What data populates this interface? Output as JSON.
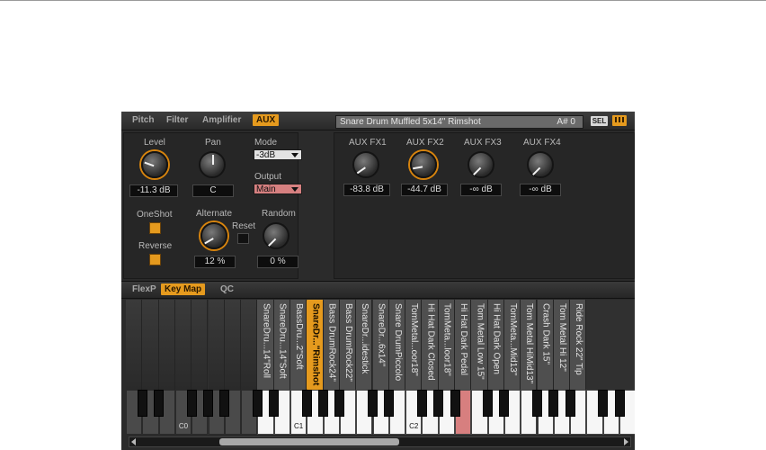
{
  "tabs": [
    "Pitch",
    "Filter",
    "Amplifier",
    "AUX"
  ],
  "active_tab": "AUX",
  "sample": {
    "name": "Snare Drum Muffled 5x14\" Rimshot",
    "note": "A# 0"
  },
  "sel_label": "SEL",
  "level": {
    "label": "Level",
    "value": "-11.3 dB"
  },
  "pan": {
    "label": "Pan",
    "value": "C"
  },
  "mode": {
    "label": "Mode",
    "value": "-3dB"
  },
  "output": {
    "label": "Output",
    "value": "Main"
  },
  "oneshot_label": "OneShot",
  "reverse_label": "Reverse",
  "alternate": {
    "label": "Alternate",
    "value": "12 %"
  },
  "reset_label": "Reset",
  "random": {
    "label": "Random",
    "value": "0 %"
  },
  "aux_fx": [
    {
      "label": "AUX FX1",
      "value": "-83.8 dB"
    },
    {
      "label": "AUX FX2",
      "value": "-44.7 dB"
    },
    {
      "label": "AUX FX3",
      "value": "-∞ dB"
    },
    {
      "label": "AUX FX4",
      "value": "-∞ dB"
    }
  ],
  "lower_tabs": [
    "FlexP",
    "Key Map",
    "QC"
  ],
  "active_lower_tab": "Key Map",
  "key_map": [
    "SnareDru...14\"Roll",
    "SnareDru...14\"Soft",
    "BassDru...2\"Soft",
    "SnareDr...\"Rimshot",
    "Bass DrumRock24\"",
    "Bass DrumRock22\"",
    "SnareDr...idestick",
    "SnareDr...6x14\"",
    "Snare DrumPiccolo",
    "TomMetal...oor18\"",
    "Hi Hat Dark Closed",
    "TomMeta...loor18\"",
    "Hi Hat Dark Pedal",
    "Tom Metal Low 15\"",
    "Hi Hat Dark Open",
    "TomMeta...Mid13\"",
    "Tom Metal HiMid13\"",
    "Crash Dark 15\"",
    "Tom Metal Hi 12\"",
    "Ride Rock 22\" Tip"
  ],
  "octave_labels": [
    "C0",
    "C1",
    "C2"
  ]
}
